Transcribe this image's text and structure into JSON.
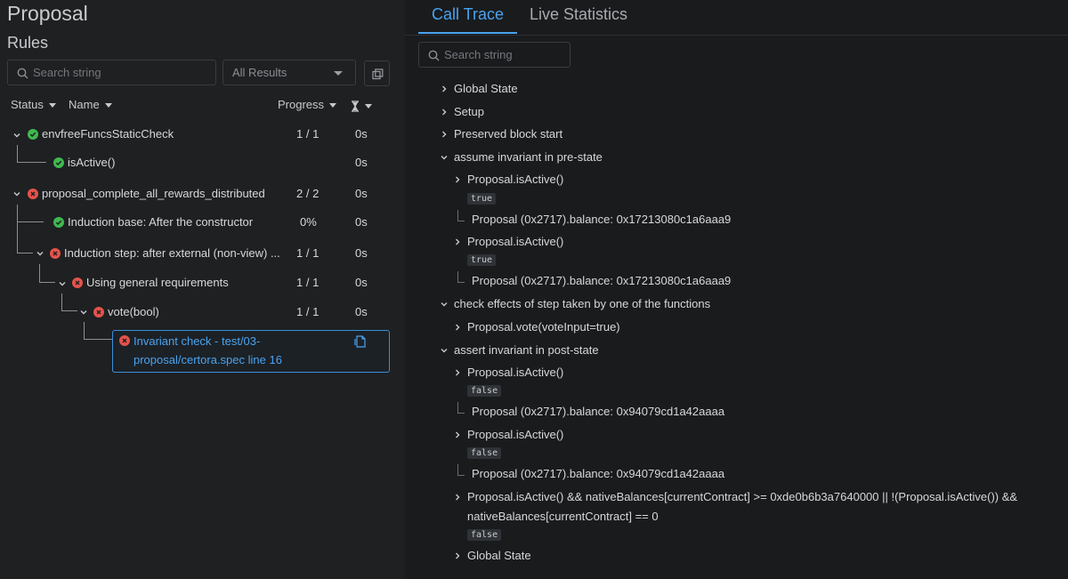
{
  "left": {
    "app_title": "Proposal",
    "section_title": "Rules",
    "search_placeholder": "Search string",
    "filter_value": "All Results",
    "columns": {
      "status": "Status",
      "name": "Name",
      "progress": "Progress"
    },
    "rows": [
      {
        "label": "envfreeFuncsStaticCheck",
        "status": "pass",
        "progress": "1 / 1",
        "time": "0s"
      },
      {
        "label": "isActive()",
        "status": "pass",
        "progress": "",
        "time": "0s"
      },
      {
        "label": "proposal_complete_all_rewards_distributed",
        "status": "fail",
        "progress": "2 / 2",
        "time": "0s"
      },
      {
        "label": "Induction base: After the constructor",
        "status": "pass",
        "progress": "0%",
        "time": "0s"
      },
      {
        "label": "Induction step: after external (non-view) ...",
        "status": "fail",
        "progress": "1 / 1",
        "time": "0s"
      },
      {
        "label": "Using general requirements",
        "status": "fail",
        "progress": "1 / 1",
        "time": "0s"
      },
      {
        "label": "vote(bool)",
        "status": "fail",
        "progress": "1 / 1",
        "time": "0s"
      }
    ],
    "selected": {
      "label": "Invariant check - test/03-proposal/certora.spec line 16",
      "status": "fail"
    }
  },
  "right": {
    "tabs": [
      "Call Trace",
      "Live Statistics"
    ],
    "active_tab": "Call Trace",
    "search_placeholder": "Search string",
    "trace": {
      "global_state": "Global State",
      "setup": "Setup",
      "preserved": "Preserved block start",
      "assume": "assume invariant in pre-state",
      "is_active": "Proposal.isActive()",
      "true_badge": "true",
      "false_badge": "false",
      "balance_pre": "Proposal (0x2717).balance: 0x17213080c1a6aaa9",
      "check_effects": "check effects of step taken by one of the functions",
      "vote_call": "Proposal.vote(voteInput=true)",
      "assert": "assert invariant in post-state",
      "balance_post": "Proposal (0x2717).balance: 0x94079cd1a42aaaa",
      "expr_line1": "Proposal.isActive() && nativeBalances[currentContract] >= 0xde0b6b3a7640000 || !(Proposal.isActive()) &&",
      "expr_line2": "nativeBalances[currentContract] == 0",
      "global_state_2": "Global State"
    }
  },
  "colors": {
    "accent": "#4aa3ef",
    "pass": "#3fb950",
    "fail": "#e5534b"
  }
}
